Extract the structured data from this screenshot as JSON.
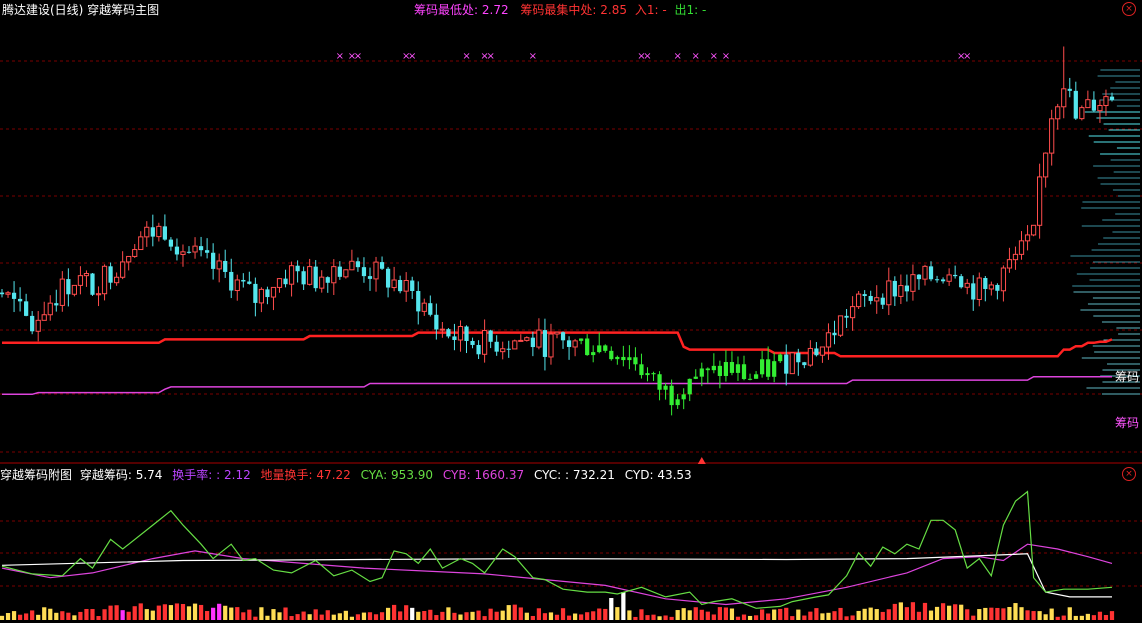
{
  "header": {
    "title": "腾达建设(日线) 穿越筹码主图",
    "low_label": "筹码最低处:",
    "low_value": "2.72",
    "mid_label": "筹码最集中处:",
    "mid_value": "2.85",
    "in_label": "入1:",
    "in_value": "-",
    "out_label": "出1:",
    "out_value": "-"
  },
  "sub_header": {
    "title": "穿越筹码附图",
    "cy_label": "穿越筹码:",
    "cy_value": "5.74",
    "turnover_label": "换手率:",
    "turnover_value": ": 2.12",
    "dl_label": "地量换手:",
    "dl_value": "47.22",
    "cya_label": "CYA:",
    "cya_value": "953.90",
    "cyb_label": "CYB:",
    "cyb_value": "1660.37",
    "cyc_label": "CYC:",
    "cyc_value": ": 732.21",
    "cyd_label": "CYD:",
    "cyd_value": "43.53"
  },
  "side_labels": {
    "red_line": "筹码",
    "magenta_line": "筹码"
  },
  "icons": {
    "close": "close-icon",
    "marker": "signal-x-icon",
    "arrow": "up-triangle-icon"
  },
  "colors": {
    "background": "#000000",
    "up": "#ff4d4d",
    "down": "#55e6ee",
    "chip_zone": "#33ee33",
    "red_line": "#ff2222",
    "magenta": "#dd44dd",
    "green_line": "#66dd44",
    "white_line": "#ffffff",
    "grid": "#7a0000",
    "header_low": "#ff44ff",
    "header_mid": "#ff3333",
    "header_out": "#33dd33"
  },
  "chart_data": {
    "type": "candlestick",
    "main": {
      "ylim": [
        2.35,
        3.6
      ],
      "control_points": [
        [
          0,
          2.82
        ],
        [
          2,
          2.78
        ],
        [
          5,
          2.72
        ],
        [
          8,
          2.8
        ],
        [
          12,
          2.86
        ],
        [
          15,
          2.84
        ],
        [
          19,
          2.9
        ],
        [
          22,
          2.98
        ],
        [
          27,
          3.01
        ],
        [
          30,
          2.95
        ],
        [
          34,
          2.9
        ],
        [
          38,
          2.86
        ],
        [
          42,
          2.8
        ],
        [
          45,
          2.85
        ],
        [
          48,
          2.88
        ],
        [
          52,
          2.86
        ],
        [
          55,
          2.9
        ],
        [
          60,
          2.89
        ],
        [
          65,
          2.85
        ],
        [
          70,
          2.78
        ],
        [
          72,
          2.72
        ],
        [
          75,
          2.69
        ],
        [
          80,
          2.67
        ],
        [
          86,
          2.68
        ],
        [
          90,
          2.67
        ],
        [
          95,
          2.67
        ],
        [
          100,
          2.66
        ],
        [
          105,
          2.62
        ],
        [
          108,
          2.55
        ],
        [
          111,
          2.52
        ],
        [
          114,
          2.58
        ],
        [
          117,
          2.57
        ],
        [
          120,
          2.6
        ],
        [
          124,
          2.57
        ],
        [
          128,
          2.6
        ],
        [
          132,
          2.64
        ],
        [
          136,
          2.66
        ],
        [
          140,
          2.76
        ],
        [
          145,
          2.82
        ],
        [
          150,
          2.84
        ],
        [
          155,
          2.87
        ],
        [
          158,
          2.9
        ],
        [
          160,
          2.84
        ],
        [
          163,
          2.82
        ],
        [
          166,
          2.88
        ],
        [
          169,
          2.94
        ],
        [
          171,
          2.98
        ],
        [
          172,
          3.15
        ],
        [
          174,
          3.35
        ],
        [
          176,
          3.45
        ],
        [
          178,
          3.33
        ],
        [
          181,
          3.38
        ],
        [
          184,
          3.4
        ]
      ],
      "red_line_steps": [
        [
          0,
          2.672
        ],
        [
          26,
          2.672
        ],
        [
          27,
          2.682
        ],
        [
          50,
          2.682
        ],
        [
          51,
          2.692
        ],
        [
          68,
          2.692
        ],
        [
          69,
          2.702
        ],
        [
          112,
          2.702
        ],
        [
          113,
          2.66
        ],
        [
          114,
          2.652
        ],
        [
          127,
          2.652
        ],
        [
          128,
          2.642
        ],
        [
          138,
          2.642
        ],
        [
          139,
          2.632
        ],
        [
          175,
          2.632
        ],
        [
          176,
          2.652
        ],
        [
          178,
          2.662
        ],
        [
          180,
          2.672
        ],
        [
          182,
          2.675
        ],
        [
          184,
          2.682
        ]
      ],
      "magenta_steps": [
        [
          0,
          2.52
        ],
        [
          6,
          2.525
        ],
        [
          27,
          2.535
        ],
        [
          28,
          2.542
        ],
        [
          60,
          2.542
        ],
        [
          61,
          2.552
        ],
        [
          140,
          2.552
        ],
        [
          141,
          2.562
        ],
        [
          170,
          2.562
        ],
        [
          171,
          2.572
        ],
        [
          184,
          2.572
        ]
      ],
      "signal_x_indices": [
        56,
        58,
        59,
        67,
        68,
        77,
        80,
        81,
        88,
        106,
        107,
        112,
        115,
        118,
        120,
        159,
        160
      ],
      "arrow_index": 116
    },
    "sub": {
      "ylim": [
        0,
        140
      ],
      "green_points": [
        [
          0,
          52
        ],
        [
          5,
          44
        ],
        [
          10,
          42
        ],
        [
          13,
          60
        ],
        [
          15,
          50
        ],
        [
          18,
          80
        ],
        [
          20,
          70
        ],
        [
          25,
          95
        ],
        [
          28,
          110
        ],
        [
          30,
          95
        ],
        [
          33,
          75
        ],
        [
          35,
          60
        ],
        [
          38,
          75
        ],
        [
          40,
          58
        ],
        [
          42,
          60
        ],
        [
          45,
          48
        ],
        [
          48,
          45
        ],
        [
          52,
          58
        ],
        [
          55,
          42
        ],
        [
          58,
          48
        ],
        [
          61,
          36
        ],
        [
          63,
          40
        ],
        [
          65,
          68
        ],
        [
          67,
          65
        ],
        [
          69,
          55
        ],
        [
          71,
          70
        ],
        [
          73,
          50
        ],
        [
          76,
          60
        ],
        [
          78,
          55
        ],
        [
          80,
          45
        ],
        [
          83,
          70
        ],
        [
          85,
          62
        ],
        [
          88,
          40
        ],
        [
          90,
          38
        ],
        [
          93,
          28
        ],
        [
          97,
          25
        ],
        [
          100,
          25
        ],
        [
          102,
          23
        ],
        [
          106,
          30
        ],
        [
          110,
          20
        ],
        [
          114,
          25
        ],
        [
          116,
          12
        ],
        [
          118,
          15
        ],
        [
          121,
          18
        ],
        [
          125,
          8
        ],
        [
          129,
          10
        ],
        [
          131,
          15
        ],
        [
          135,
          20
        ],
        [
          137,
          22
        ],
        [
          140,
          42
        ],
        [
          142,
          66
        ],
        [
          144,
          52
        ],
        [
          146,
          72
        ],
        [
          148,
          65
        ],
        [
          150,
          75
        ],
        [
          152,
          70
        ],
        [
          154,
          100
        ],
        [
          156,
          100
        ],
        [
          158,
          90
        ],
        [
          160,
          50
        ],
        [
          162,
          60
        ],
        [
          164,
          42
        ],
        [
          166,
          95
        ],
        [
          168,
          120
        ],
        [
          170,
          130
        ],
        [
          171,
          40
        ],
        [
          173,
          25
        ],
        [
          176,
          28
        ],
        [
          180,
          28
        ],
        [
          184,
          30
        ]
      ],
      "magenta_points": [
        [
          0,
          50
        ],
        [
          8,
          40
        ],
        [
          15,
          45
        ],
        [
          25,
          60
        ],
        [
          32,
          68
        ],
        [
          40,
          60
        ],
        [
          50,
          55
        ],
        [
          60,
          50
        ],
        [
          70,
          47
        ],
        [
          80,
          44
        ],
        [
          90,
          38
        ],
        [
          100,
          32
        ],
        [
          110,
          18
        ],
        [
          120,
          12
        ],
        [
          130,
          18
        ],
        [
          140,
          30
        ],
        [
          150,
          45
        ],
        [
          156,
          60
        ],
        [
          162,
          62
        ],
        [
          166,
          58
        ],
        [
          170,
          75
        ],
        [
          175,
          70
        ],
        [
          180,
          62
        ],
        [
          184,
          55
        ]
      ],
      "white_points": [
        [
          0,
          53
        ],
        [
          30,
          58
        ],
        [
          60,
          59
        ],
        [
          90,
          60
        ],
        [
          130,
          59
        ],
        [
          150,
          60
        ],
        [
          170,
          65
        ],
        [
          173,
          25
        ],
        [
          177,
          20
        ],
        [
          184,
          20
        ]
      ]
    }
  }
}
